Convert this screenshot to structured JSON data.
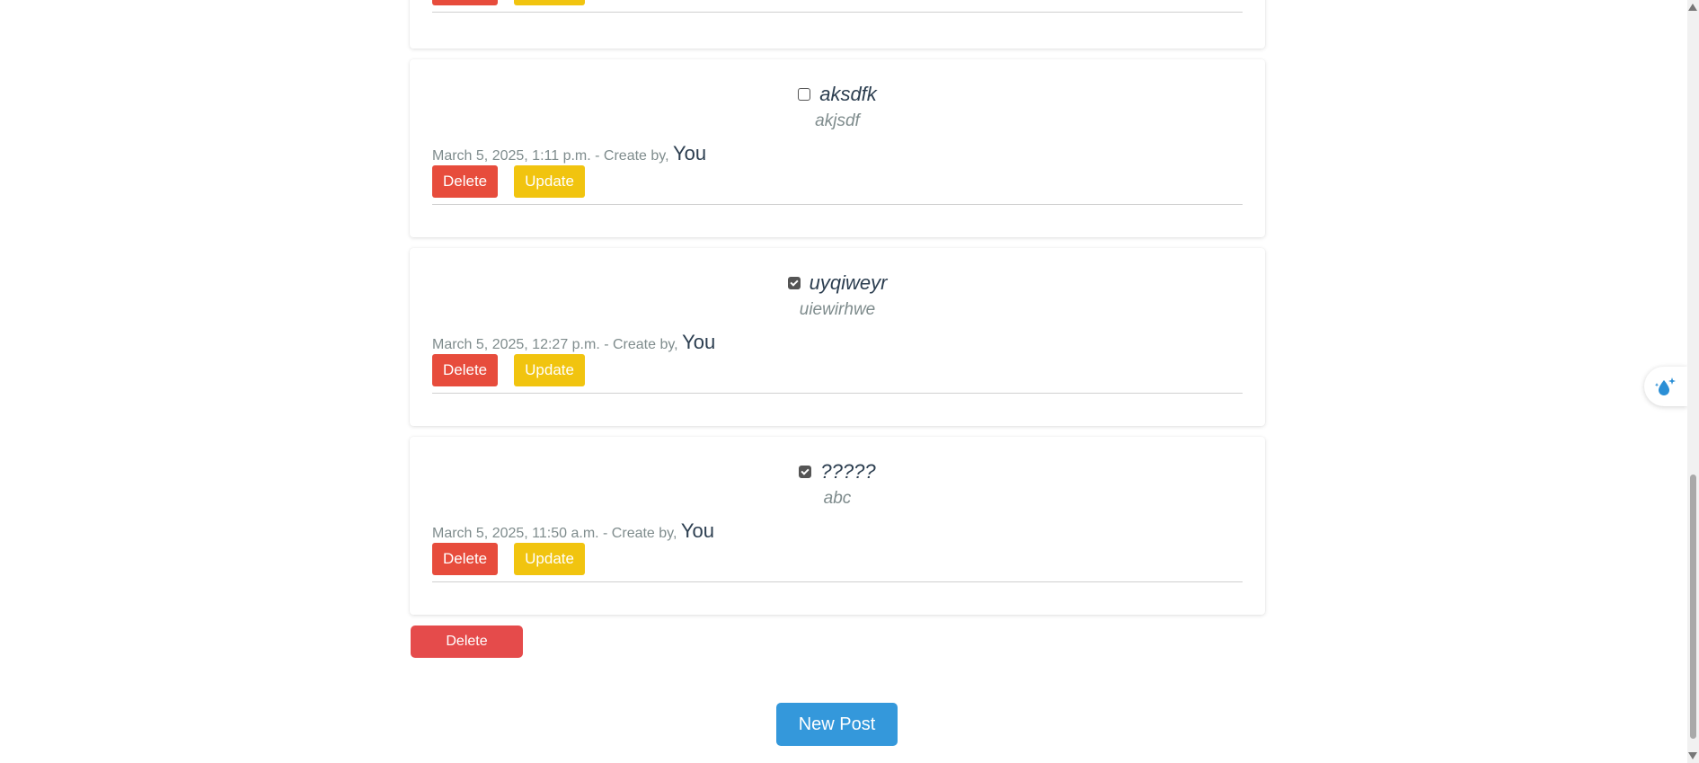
{
  "posts": [
    {
      "title": "aksdfk",
      "checked": false,
      "body": "akjsdf",
      "date": "March 5, 2025, 1:11 p.m. - Create by, ",
      "author": "You"
    },
    {
      "title": "uyqiweyr",
      "checked": true,
      "body": "uiewirhwe",
      "date": "March 5, 2025, 12:27 p.m. - Create by, ",
      "author": "You"
    },
    {
      "title": "?????",
      "checked": true,
      "body": "abc",
      "date": "March 5, 2025, 11:50 a.m. - Create by, ",
      "author": "You"
    }
  ],
  "actions": {
    "delete_label": "Delete",
    "update_label": "Update"
  },
  "bulk_delete_label": "Delete",
  "new_post_label": "New Post",
  "colors": {
    "delete": "#e74c3c",
    "update": "#f1c40f",
    "primary": "#3498db"
  },
  "icons": {
    "float_tab": "water-drop-sparkle-icon"
  }
}
